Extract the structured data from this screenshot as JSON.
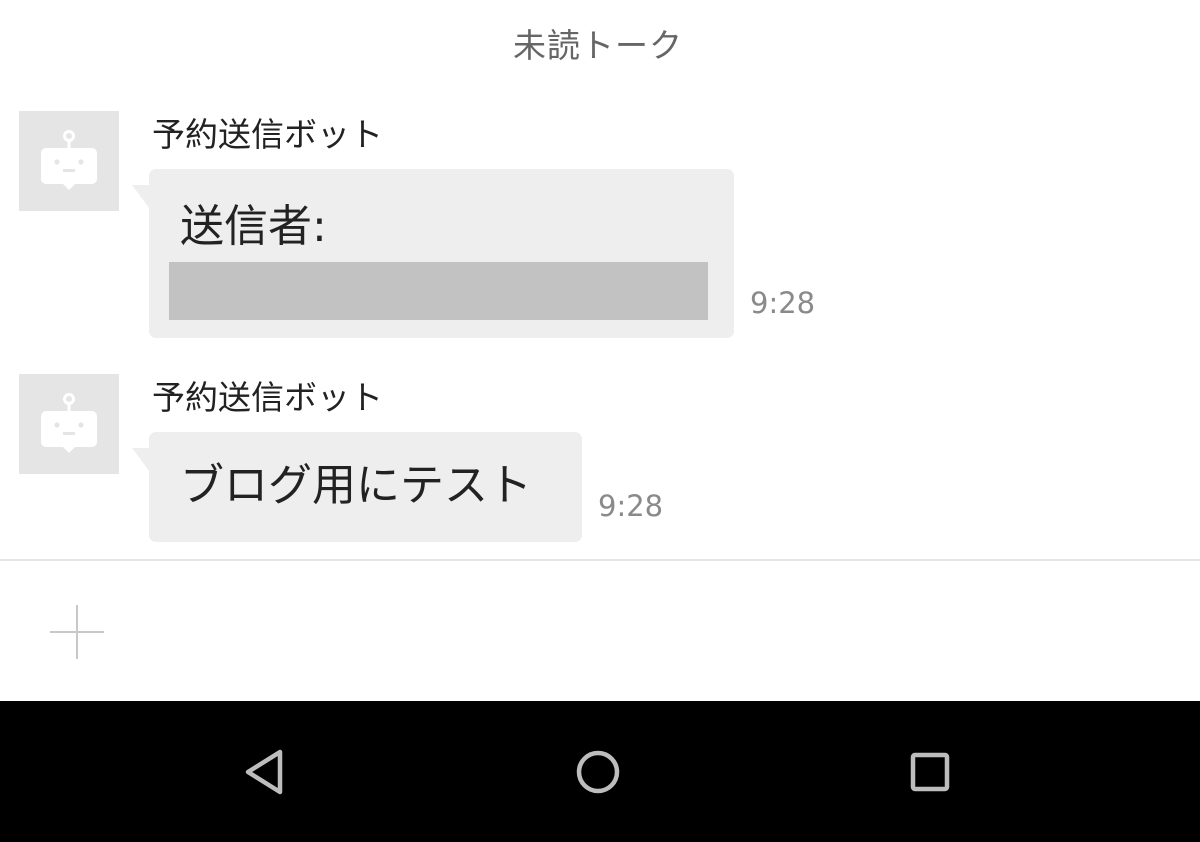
{
  "header": {
    "title": "未読トーク"
  },
  "messages": [
    {
      "sender": "予約送信ボット",
      "text": "送信者:",
      "time": "9:28",
      "redacted": true,
      "avatar_icon": "robot-icon"
    },
    {
      "sender": "予約送信ボット",
      "text": "ブログ用にテスト",
      "time": "9:28",
      "redacted": false,
      "avatar_icon": "robot-icon"
    }
  ],
  "input": {
    "add_icon": "plus-icon"
  },
  "navigation": {
    "back_icon": "back-triangle-icon",
    "home_icon": "home-circle-icon",
    "recents_icon": "recents-square-icon"
  },
  "colors": {
    "bubble": "#eeeeee",
    "avatar_bg": "#e5e5e5",
    "redaction": "#c2c2c2",
    "nav_bar": "#000000"
  }
}
